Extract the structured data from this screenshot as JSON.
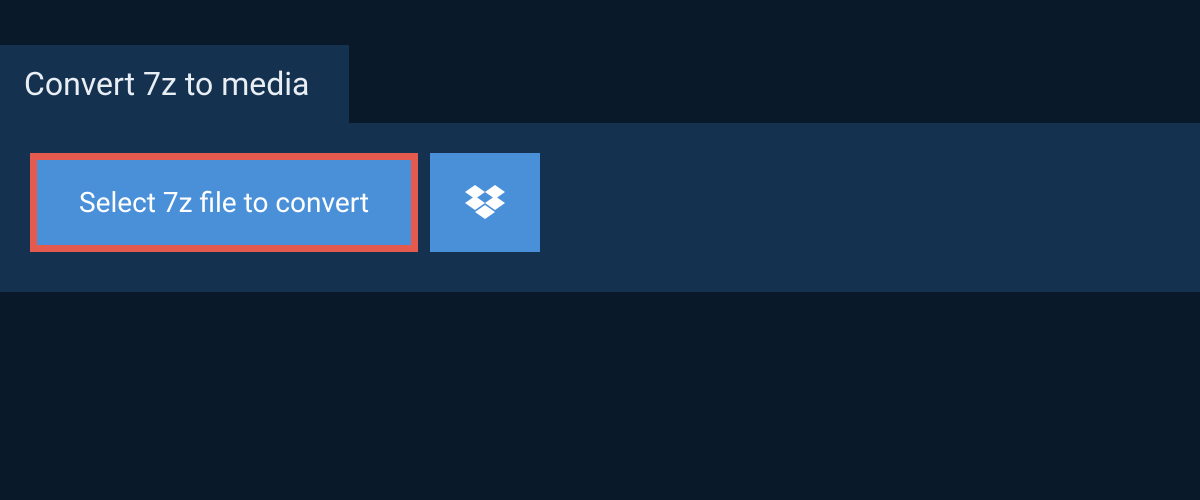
{
  "tab": {
    "title": "Convert 7z to media"
  },
  "actions": {
    "select_file_label": "Select 7z file to convert"
  },
  "colors": {
    "background": "#0a1929",
    "panel": "#14324f",
    "button": "#4a90d9",
    "highlight_border": "#e55a4f"
  }
}
